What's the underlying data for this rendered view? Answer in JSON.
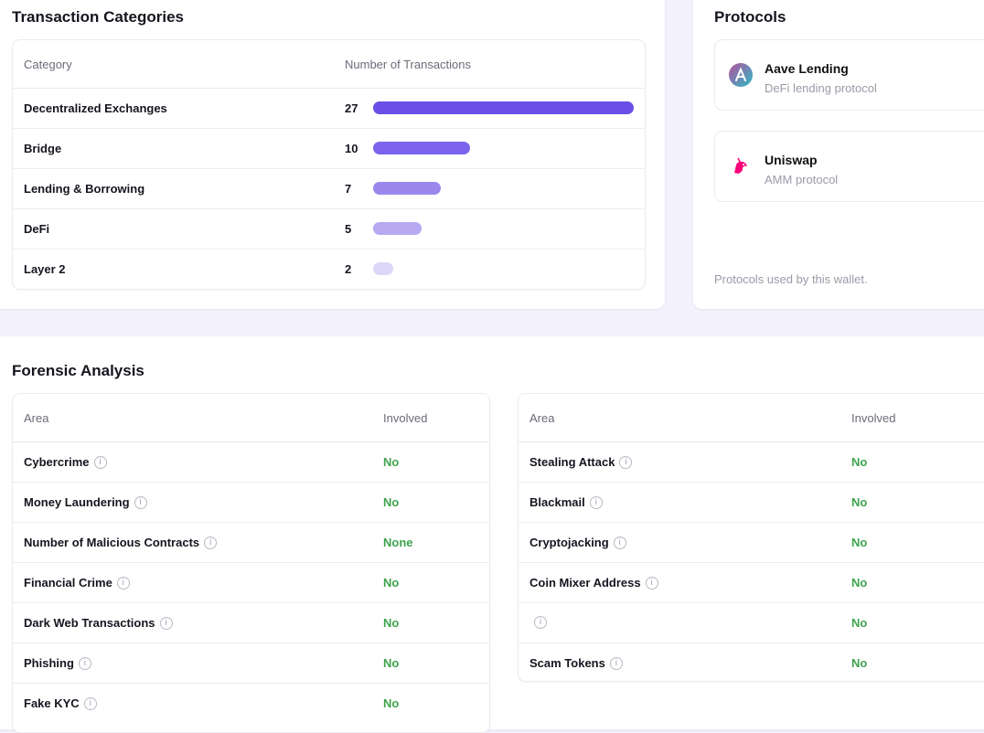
{
  "transaction_categories": {
    "title": "Transaction Categories",
    "header_category": "Category",
    "header_count": "Number of Transactions",
    "rows": [
      {
        "name": "Decentralized Exchanges",
        "count": "27",
        "value": 27,
        "color": "#6a4fe6"
      },
      {
        "name": "Bridge",
        "count": "10",
        "value": 10,
        "color": "#7d64ec"
      },
      {
        "name": "Lending & Borrowing",
        "count": "7",
        "value": 7,
        "color": "#9b88ee"
      },
      {
        "name": "DeFi",
        "count": "5",
        "value": 5,
        "color": "#b6a9f2"
      },
      {
        "name": "Layer 2",
        "count": "2",
        "value": 2,
        "color": "#dcd6f8"
      }
    ],
    "max_value": 27
  },
  "protocols": {
    "title": "Protocols",
    "items": [
      {
        "name": "Aave Lending",
        "desc": "DeFi lending protocol",
        "icon": "aave-logo-icon"
      },
      {
        "name": "Uniswap",
        "desc": "AMM protocol",
        "icon": "uniswap-unicorn-icon"
      }
    ],
    "note": "Protocols used by this wallet."
  },
  "forensic": {
    "title": "Forensic Analysis",
    "header_area": "Area",
    "header_involved": "Involved",
    "left_rows": [
      {
        "area": "Cybercrime",
        "involved": "No"
      },
      {
        "area": "Money Laundering",
        "involved": "No"
      },
      {
        "area": "Number of Malicious Contracts",
        "involved": "None"
      },
      {
        "area": "Financial Crime",
        "involved": "No"
      },
      {
        "area": "Dark Web Transactions",
        "involved": "No"
      },
      {
        "area": "Phishing",
        "involved": "No"
      },
      {
        "area": "Fake KYC",
        "involved": "No"
      }
    ],
    "right_rows": [
      {
        "area": "Stealing Attack",
        "involved": "No"
      },
      {
        "area": "Blackmail",
        "involved": "No"
      },
      {
        "area": "Cryptojacking",
        "involved": "No"
      },
      {
        "area": "Coin Mixer Address",
        "involved": "No"
      },
      {
        "area": "",
        "involved": "No"
      },
      {
        "area": "Scam Tokens",
        "involved": "No"
      }
    ],
    "info_glyph": "i",
    "status_color": "#3fa34d"
  }
}
